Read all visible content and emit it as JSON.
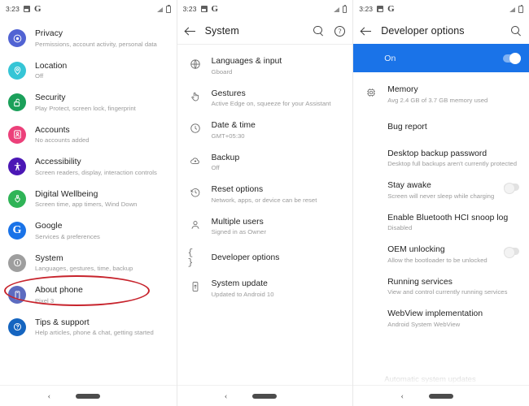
{
  "status_bar": {
    "time": "3:23",
    "icons": [
      "screenshot-icon",
      "google-icon"
    ],
    "right_icons": [
      "signal-icon",
      "battery-icon"
    ]
  },
  "colors": {
    "accent_blue": "#1a73e8",
    "highlight_red": "#c7232c",
    "title_text": "#1f1f1f",
    "subtitle_text": "#9b9b9b"
  },
  "panels": [
    {
      "id": "settings-panel",
      "appbar": {
        "title": "",
        "show": false
      },
      "items": [
        {
          "title": "Privacy",
          "subtitle": "Permissions, account activity, personal data",
          "icon": "privacy-icon",
          "color": "#5163d3"
        },
        {
          "title": "Location",
          "subtitle": "Off",
          "icon": "location-pin-icon",
          "color": "#36c5d6"
        },
        {
          "title": "Security",
          "subtitle": "Play Protect, screen lock, fingerprint",
          "icon": "unlock-icon",
          "color": "#1ba05a"
        },
        {
          "title": "Accounts",
          "subtitle": "No accounts added",
          "icon": "accounts-icon",
          "color": "#ec407a"
        },
        {
          "title": "Accessibility",
          "subtitle": "Screen readers, display, interaction controls",
          "icon": "accessibility-icon",
          "color": "#4b17b5"
        },
        {
          "title": "Digital Wellbeing",
          "subtitle": "Screen time, app timers, Wind Down",
          "icon": "wellbeing-heart-icon",
          "color": "#2fb457"
        },
        {
          "title": "Google",
          "subtitle": "Services & preferences",
          "icon": "google-g-icon",
          "color": "#1a73e8"
        },
        {
          "title": "System",
          "subtitle": "Languages, gestures, time, backup",
          "icon": "system-info-icon",
          "color": "#9e9e9e",
          "highlighted": true
        },
        {
          "title": "About phone",
          "subtitle": "Pixel 3",
          "icon": "phone-icon",
          "color": "#5c6bc0"
        },
        {
          "title": "Tips & support",
          "subtitle": "Help articles, phone & chat, getting started",
          "icon": "help-icon",
          "color": "#1565c0"
        }
      ]
    },
    {
      "id": "system-panel",
      "appbar": {
        "title": "System",
        "show": true,
        "actions": [
          "search-icon",
          "help-icon"
        ]
      },
      "items": [
        {
          "title": "Languages & input",
          "subtitle": "Gboard",
          "icon": "globe-icon"
        },
        {
          "title": "Gestures",
          "subtitle": "Active Edge on, squeeze for your Assistant",
          "icon": "gesture-icon"
        },
        {
          "title": "Date & time",
          "subtitle": "GMT+05:30",
          "icon": "clock-icon"
        },
        {
          "title": "Backup",
          "subtitle": "Off",
          "icon": "cloud-upload-icon"
        },
        {
          "title": "Reset options",
          "subtitle": "Network, apps, or device can be reset",
          "icon": "history-reset-icon"
        },
        {
          "title": "Multiple users",
          "subtitle": "Signed in as Owner",
          "icon": "person-icon"
        },
        {
          "title": "Developer options",
          "subtitle": "",
          "icon": "braces-icon",
          "highlighted": true
        },
        {
          "title": "System update",
          "subtitle": "Updated to Android 10",
          "icon": "system-update-icon"
        }
      ]
    },
    {
      "id": "developer-options-panel",
      "appbar": {
        "title": "Developer options",
        "show": true,
        "actions": [
          "search-icon"
        ]
      },
      "master_toggle": {
        "label": "On",
        "state": "on"
      },
      "items": [
        {
          "title": "Memory",
          "subtitle": "Avg 2.4 GB of 3.7 GB memory used",
          "icon": "memory-chip-icon"
        },
        {
          "title": "Bug report",
          "subtitle": ""
        },
        {
          "title": "Desktop backup password",
          "subtitle": "Desktop full backups aren't currently protected"
        },
        {
          "title": "Stay awake",
          "subtitle": "Screen will never sleep while charging",
          "toggle": "off"
        },
        {
          "title": "Enable Bluetooth HCI snoop log",
          "subtitle": "Disabled"
        },
        {
          "title": "OEM unlocking",
          "subtitle": "Allow the bootloader to be unlocked",
          "toggle": "off"
        },
        {
          "title": "Running services",
          "subtitle": "View and control currently running services"
        },
        {
          "title": "WebView implementation",
          "subtitle": "Android System WebView"
        },
        {
          "title": "Automatic system updates",
          "subtitle": "",
          "clipped": true
        }
      ]
    }
  ],
  "nav_bar": {
    "back": "‹",
    "home_pill": "home-pill"
  }
}
